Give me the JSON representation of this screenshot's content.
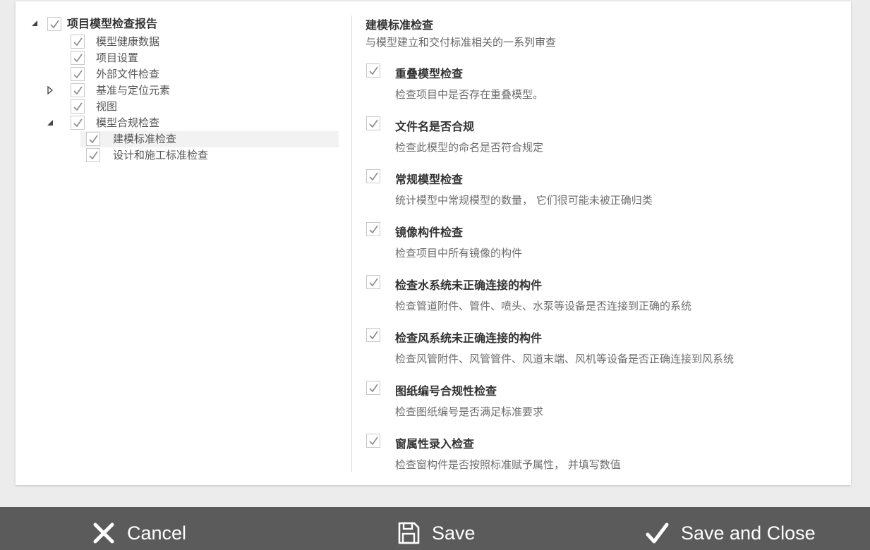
{
  "tree": {
    "root": {
      "label": "项目模型检查报告",
      "checked": true,
      "expanded": true
    },
    "items": [
      {
        "label": "模型健康数据",
        "checked": true
      },
      {
        "label": "项目设置",
        "checked": true
      },
      {
        "label": "外部文件检查",
        "checked": true
      },
      {
        "label": "基准与定位元素",
        "checked": true,
        "expanded": false
      },
      {
        "label": "视图",
        "checked": true
      },
      {
        "label": "模型合规检查",
        "checked": true,
        "expanded": true
      },
      {
        "label": "建模标准检查",
        "checked": true,
        "selected": true
      },
      {
        "label": "设计和施工标准检查",
        "checked": true
      }
    ]
  },
  "details": {
    "title": "建模标准检查",
    "subtitle": "与模型建立和交付标准相关的一系列审查",
    "checks": [
      {
        "name": "重叠模型检查",
        "desc": "检查项目中是否存在重叠模型。",
        "checked": true
      },
      {
        "name": "文件名是否合规",
        "desc": "检查此模型的命名是否符合规定",
        "checked": true
      },
      {
        "name": "常规模型检查",
        "desc": "统计模型中常规模型的数量， 它们很可能未被正确归类",
        "checked": true
      },
      {
        "name": "镜像构件检查",
        "desc": "检查项目中所有镜像的构件",
        "checked": true
      },
      {
        "name": "检查水系统未正确连接的构件",
        "desc": "检查管道附件、管件、喷头、水泵等设备是否连接到正确的系统",
        "checked": true
      },
      {
        "name": "检查风系统未正确连接的构件",
        "desc": "检查风管附件、风管管件、风道末端、风机等设备是否正确连接到风系统",
        "checked": true
      },
      {
        "name": "图纸编号合规性检查",
        "desc": "检查图纸编号是否满足标准要求",
        "checked": true
      },
      {
        "name": "窗属性录入检查",
        "desc": "检查窗构件是否按照标准赋予属性， 并填写数值",
        "checked": true
      }
    ]
  },
  "footer": {
    "cancel_label": "Cancel",
    "save_label": "Save",
    "save_close_label": "Save and Close"
  },
  "icons": {
    "cancel": "x-icon",
    "save": "floppy-disk-icon",
    "save_close": "checkmark-icon"
  },
  "colors": {
    "footer_bg": "#5b5b5b",
    "check": "#8a8a8a",
    "selected_row": "#f2f2f2"
  }
}
